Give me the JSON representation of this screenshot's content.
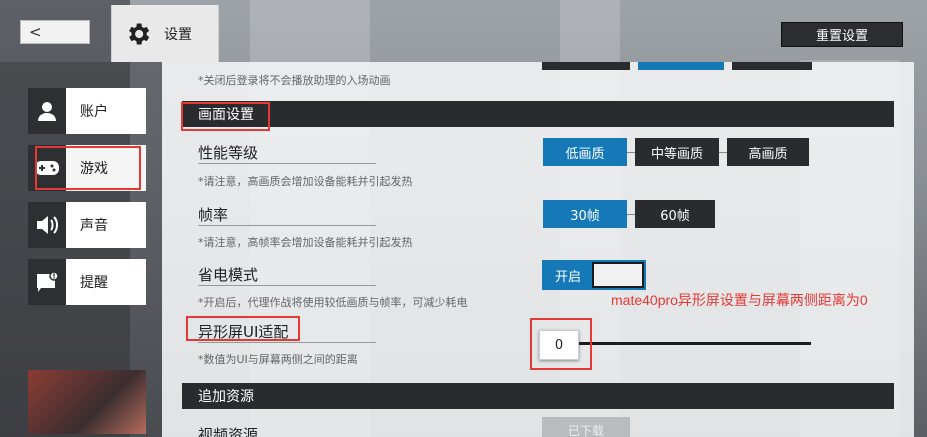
{
  "header": {
    "tab_label": "设置",
    "reset_label": "重置设置"
  },
  "nav": {
    "items": [
      {
        "label": "账户"
      },
      {
        "label": "游戏"
      },
      {
        "label": "声音"
      },
      {
        "label": "提醒"
      }
    ]
  },
  "main": {
    "top_note": "*关闭后登录将不会播放助理的入场动画",
    "display_section": {
      "title": "画面设置",
      "quality": {
        "label": "性能等级",
        "note": "*请注意，高画质会增加设备能耗并引起发热",
        "options": [
          "低画质",
          "中等画质",
          "高画质"
        ],
        "selected": "低画质"
      },
      "framerate": {
        "label": "帧率",
        "note": "*请注意，高帧率会增加设备能耗并引起发热",
        "options": [
          "30帧",
          "60帧"
        ],
        "selected": "30帧"
      },
      "power_saving": {
        "label": "省电模式",
        "note": "*开启后，代理作战将使用较低画质与帧率，可减少耗电",
        "toggle_label": "开启",
        "enabled": true
      },
      "notch_fit": {
        "label": "异形屏UI适配",
        "note": "*数值为UI与屏幕两侧之间的距离",
        "value": "0"
      }
    },
    "resources_section": {
      "title": "追加资源",
      "video": {
        "label": "视频资源",
        "button_label": "已下载"
      }
    }
  },
  "annotation": {
    "text": "mate40pro异形屏设置与屏幕两侧距离为0",
    "color": "#e53935"
  },
  "colors": {
    "accent": "#1579b8",
    "dark": "#2a2b2e"
  }
}
